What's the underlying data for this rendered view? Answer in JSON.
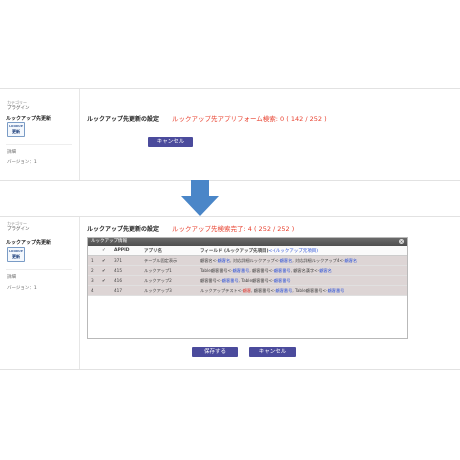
{
  "colors": {
    "accent": "#4b4b9c",
    "status": "#e8402e",
    "link": "#2a4fd8",
    "arrow": "#4a86c8"
  },
  "sidebar": {
    "category": "カテゴリー",
    "plugin": "プラグイン",
    "app_name": "ルックアップ先更新",
    "icon_top": "LOOKUP",
    "icon_bottom": "更新",
    "detail": "詳細",
    "version": "バージョン：1"
  },
  "before": {
    "title": "ルックアップ先更新の設定",
    "status": "ルックアップ先アプリフォーム検索: 0 ( 142 / 252 )",
    "cancel": "キャンセル"
  },
  "after": {
    "title": "ルックアップ先更新の設定",
    "status": "ルックアップ先検索完了: 4 ( 252 / 252 )",
    "save": "保存する",
    "cancel": "キャンセル"
  },
  "table": {
    "caption": "ルックアップ情報",
    "close_icon": "close-icon",
    "headers": {
      "check": "✓",
      "appid": "APPID",
      "app": "アプリ名",
      "field": "フィールド (ルックアップ先項目)",
      "field_hint": "<-(ルックアップ元項目)"
    },
    "rows": [
      {
        "no": "1",
        "chk": "✔",
        "appid": "371",
        "app": "テーブル固定表示",
        "field": [
          [
            "顧客名<-",
            "n"
          ],
          [
            "顧客名",
            "b"
          ],
          [
            ", 対応詳細ルックアップ<-",
            "n"
          ],
          [
            "顧客名",
            "b"
          ],
          [
            ", 対応詳細ルックアップ4<-",
            "n"
          ],
          [
            "顧客名",
            "b"
          ]
        ]
      },
      {
        "no": "2",
        "chk": "✔",
        "appid": "415",
        "app": "ルックアップ1",
        "field": [
          [
            "Table顧客番号<-",
            "n"
          ],
          [
            "顧客番号",
            "b"
          ],
          [
            ", 顧客番号<-",
            "n"
          ],
          [
            "顧客番号",
            "b"
          ],
          [
            ", 顧客名漢字<-",
            "n"
          ],
          [
            "顧客名",
            "b"
          ]
        ]
      },
      {
        "no": "3",
        "chk": "✔",
        "appid": "416",
        "app": "ルックアップ2",
        "field": [
          [
            "顧客番号<-",
            "n"
          ],
          [
            "顧客番号",
            "b"
          ],
          [
            ", Table顧客番号<-",
            "n"
          ],
          [
            "顧客番号",
            "b"
          ]
        ]
      },
      {
        "no": "4",
        "chk": "",
        "appid": "417",
        "app": "ルックアップ3",
        "field": [
          [
            "ルックアップテスト<-",
            "n"
          ],
          [
            "顧客",
            "r"
          ],
          [
            ", 顧客番号<-",
            "n"
          ],
          [
            "顧客番号",
            "b"
          ],
          [
            ", Table顧客番号<-",
            "n"
          ],
          [
            "顧客番号",
            "b"
          ]
        ]
      }
    ]
  }
}
